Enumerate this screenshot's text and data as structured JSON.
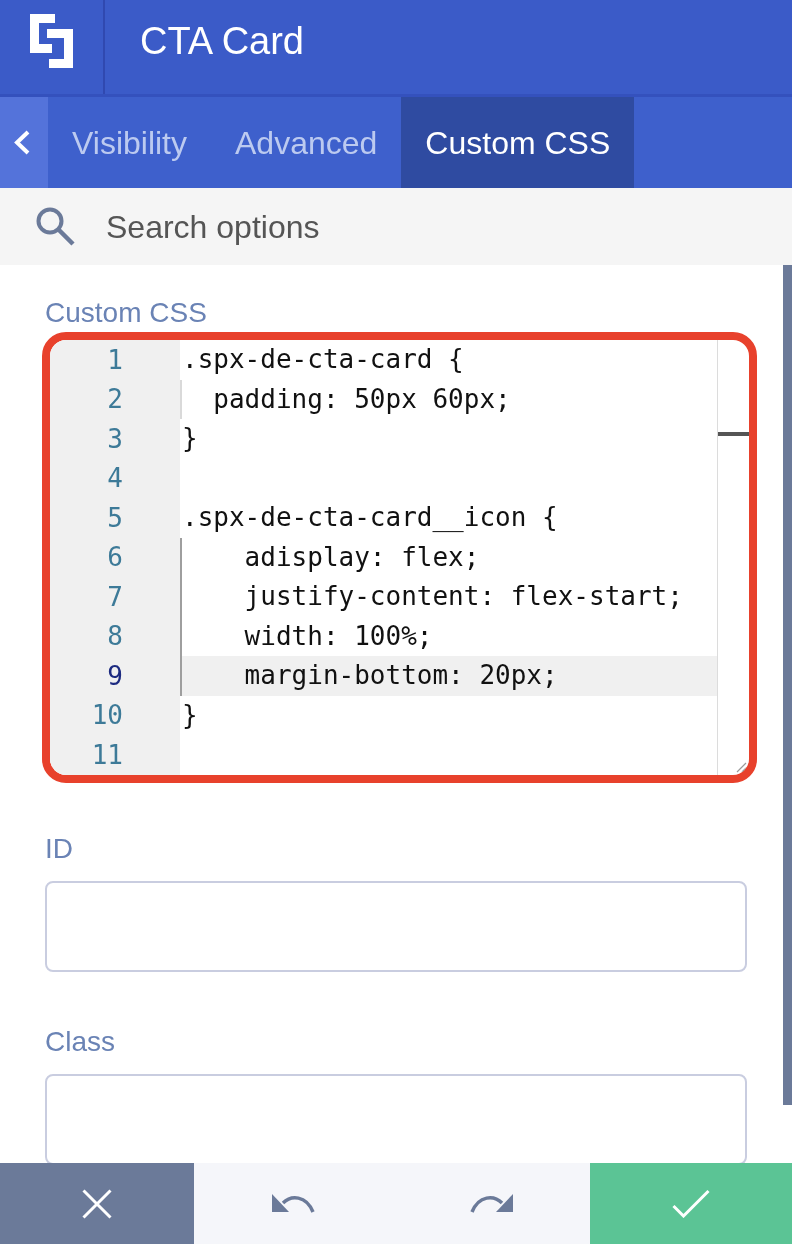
{
  "header": {
    "title": "CTA Card"
  },
  "tabs": [
    {
      "label": "Visibility",
      "selected": false
    },
    {
      "label": "Advanced",
      "selected": false
    },
    {
      "label": "Custom CSS",
      "selected": true
    }
  ],
  "search": {
    "placeholder": "Search options"
  },
  "custom_css": {
    "label": "Custom CSS",
    "lines": [
      {
        "number": "1",
        "code": ".spx-de-cta-card {",
        "active": false,
        "indent_guide": false
      },
      {
        "number": "2",
        "code": "  padding: 50px 60px;",
        "active": false,
        "indent_guide": true,
        "guide_highlighted": false
      },
      {
        "number": "3",
        "code": "}",
        "active": false,
        "indent_guide": false
      },
      {
        "number": "4",
        "active": false,
        "indent_guide": false
      },
      {
        "number": "5",
        "code": ".spx-de-cta-card__icon {",
        "active": false,
        "indent_guide": false
      },
      {
        "number": "6",
        "code": "    adisplay: flex;",
        "active": false,
        "indent_guide": true,
        "guide_highlighted": true
      },
      {
        "number": "7",
        "code": "    justify-content: flex-start;",
        "active": false,
        "indent_guide": true,
        "guide_highlighted": true
      },
      {
        "number": "8",
        "code": "    width: 100%;",
        "active": false,
        "indent_guide": true,
        "guide_highlighted": true
      },
      {
        "number": "9",
        "code": "    margin-bottom: 20px;",
        "active": true,
        "indent_guide": true,
        "guide_highlighted": true
      },
      {
        "number": "10",
        "code": "}",
        "active": false,
        "indent_guide": false
      },
      {
        "number": "11",
        "active": false,
        "indent_guide": false
      }
    ]
  },
  "fields": [
    {
      "label": "ID"
    },
    {
      "label": "Class"
    }
  ]
}
